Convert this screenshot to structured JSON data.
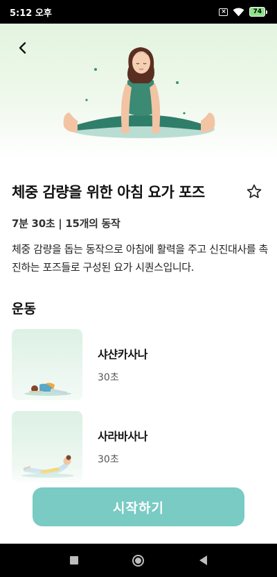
{
  "status_bar": {
    "time": "5:12 오후",
    "battery": "74"
  },
  "hero": {
    "illustration": "woman-seated-wide-leg-stretch"
  },
  "workout": {
    "title": "체중 감량을 위한 아침 요가 포즈",
    "meta": "7분 30초 | 15개의 동작",
    "description": "체중 감량을 돕는 동작으로 아침에 활력을 주고 신진대사를 촉진하는 포즈들로 구성된 요가 시퀀스입니다."
  },
  "exercises_section": {
    "title": "운동",
    "items": [
      {
        "name": "샤샨카사나",
        "duration": "30초",
        "illustration": "child-pose-figure"
      },
      {
        "name": "사라바사나",
        "duration": "30초",
        "illustration": "locust-pose-figure"
      }
    ]
  },
  "actions": {
    "start_label": "시작하기"
  },
  "colors": {
    "accent": "#79cbc4",
    "hero_bg": "#e3f4df",
    "thumb_bg": "#dcf1e4"
  },
  "icons": {
    "back": "back-arrow-icon",
    "favorite": "star-outline-icon"
  }
}
